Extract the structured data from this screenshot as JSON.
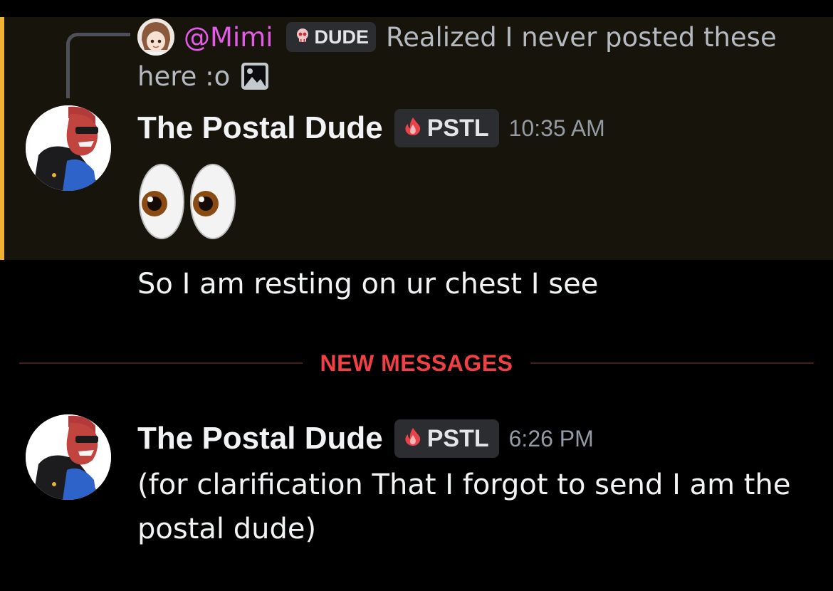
{
  "reply": {
    "mention": "@Mimi",
    "role_tag": "DUDE",
    "role_icon": "skull-icon",
    "text_line1": "Realized I never posted these",
    "text_line2": "here :o",
    "attachment_icon": "image-icon"
  },
  "messages": [
    {
      "username": "The Postal Dude",
      "tag": "PSTL",
      "tag_icon": "fire-icon",
      "timestamp": "10:35 AM",
      "emoji": "eyes",
      "followup_text": "So I am resting on ur chest I see"
    },
    {
      "username": "The Postal Dude",
      "tag": "PSTL",
      "tag_icon": "fire-icon",
      "timestamp": "6:26 PM",
      "text": "(for clarification That I forgot to send I am the postal dude)"
    }
  ],
  "divider": {
    "label": "NEW MESSAGES"
  },
  "colors": {
    "background": "#000000",
    "highlight": "#17140b",
    "highlight_border": "#f0b232",
    "mention": "#e35be6",
    "new_messages": "#f23f43"
  }
}
